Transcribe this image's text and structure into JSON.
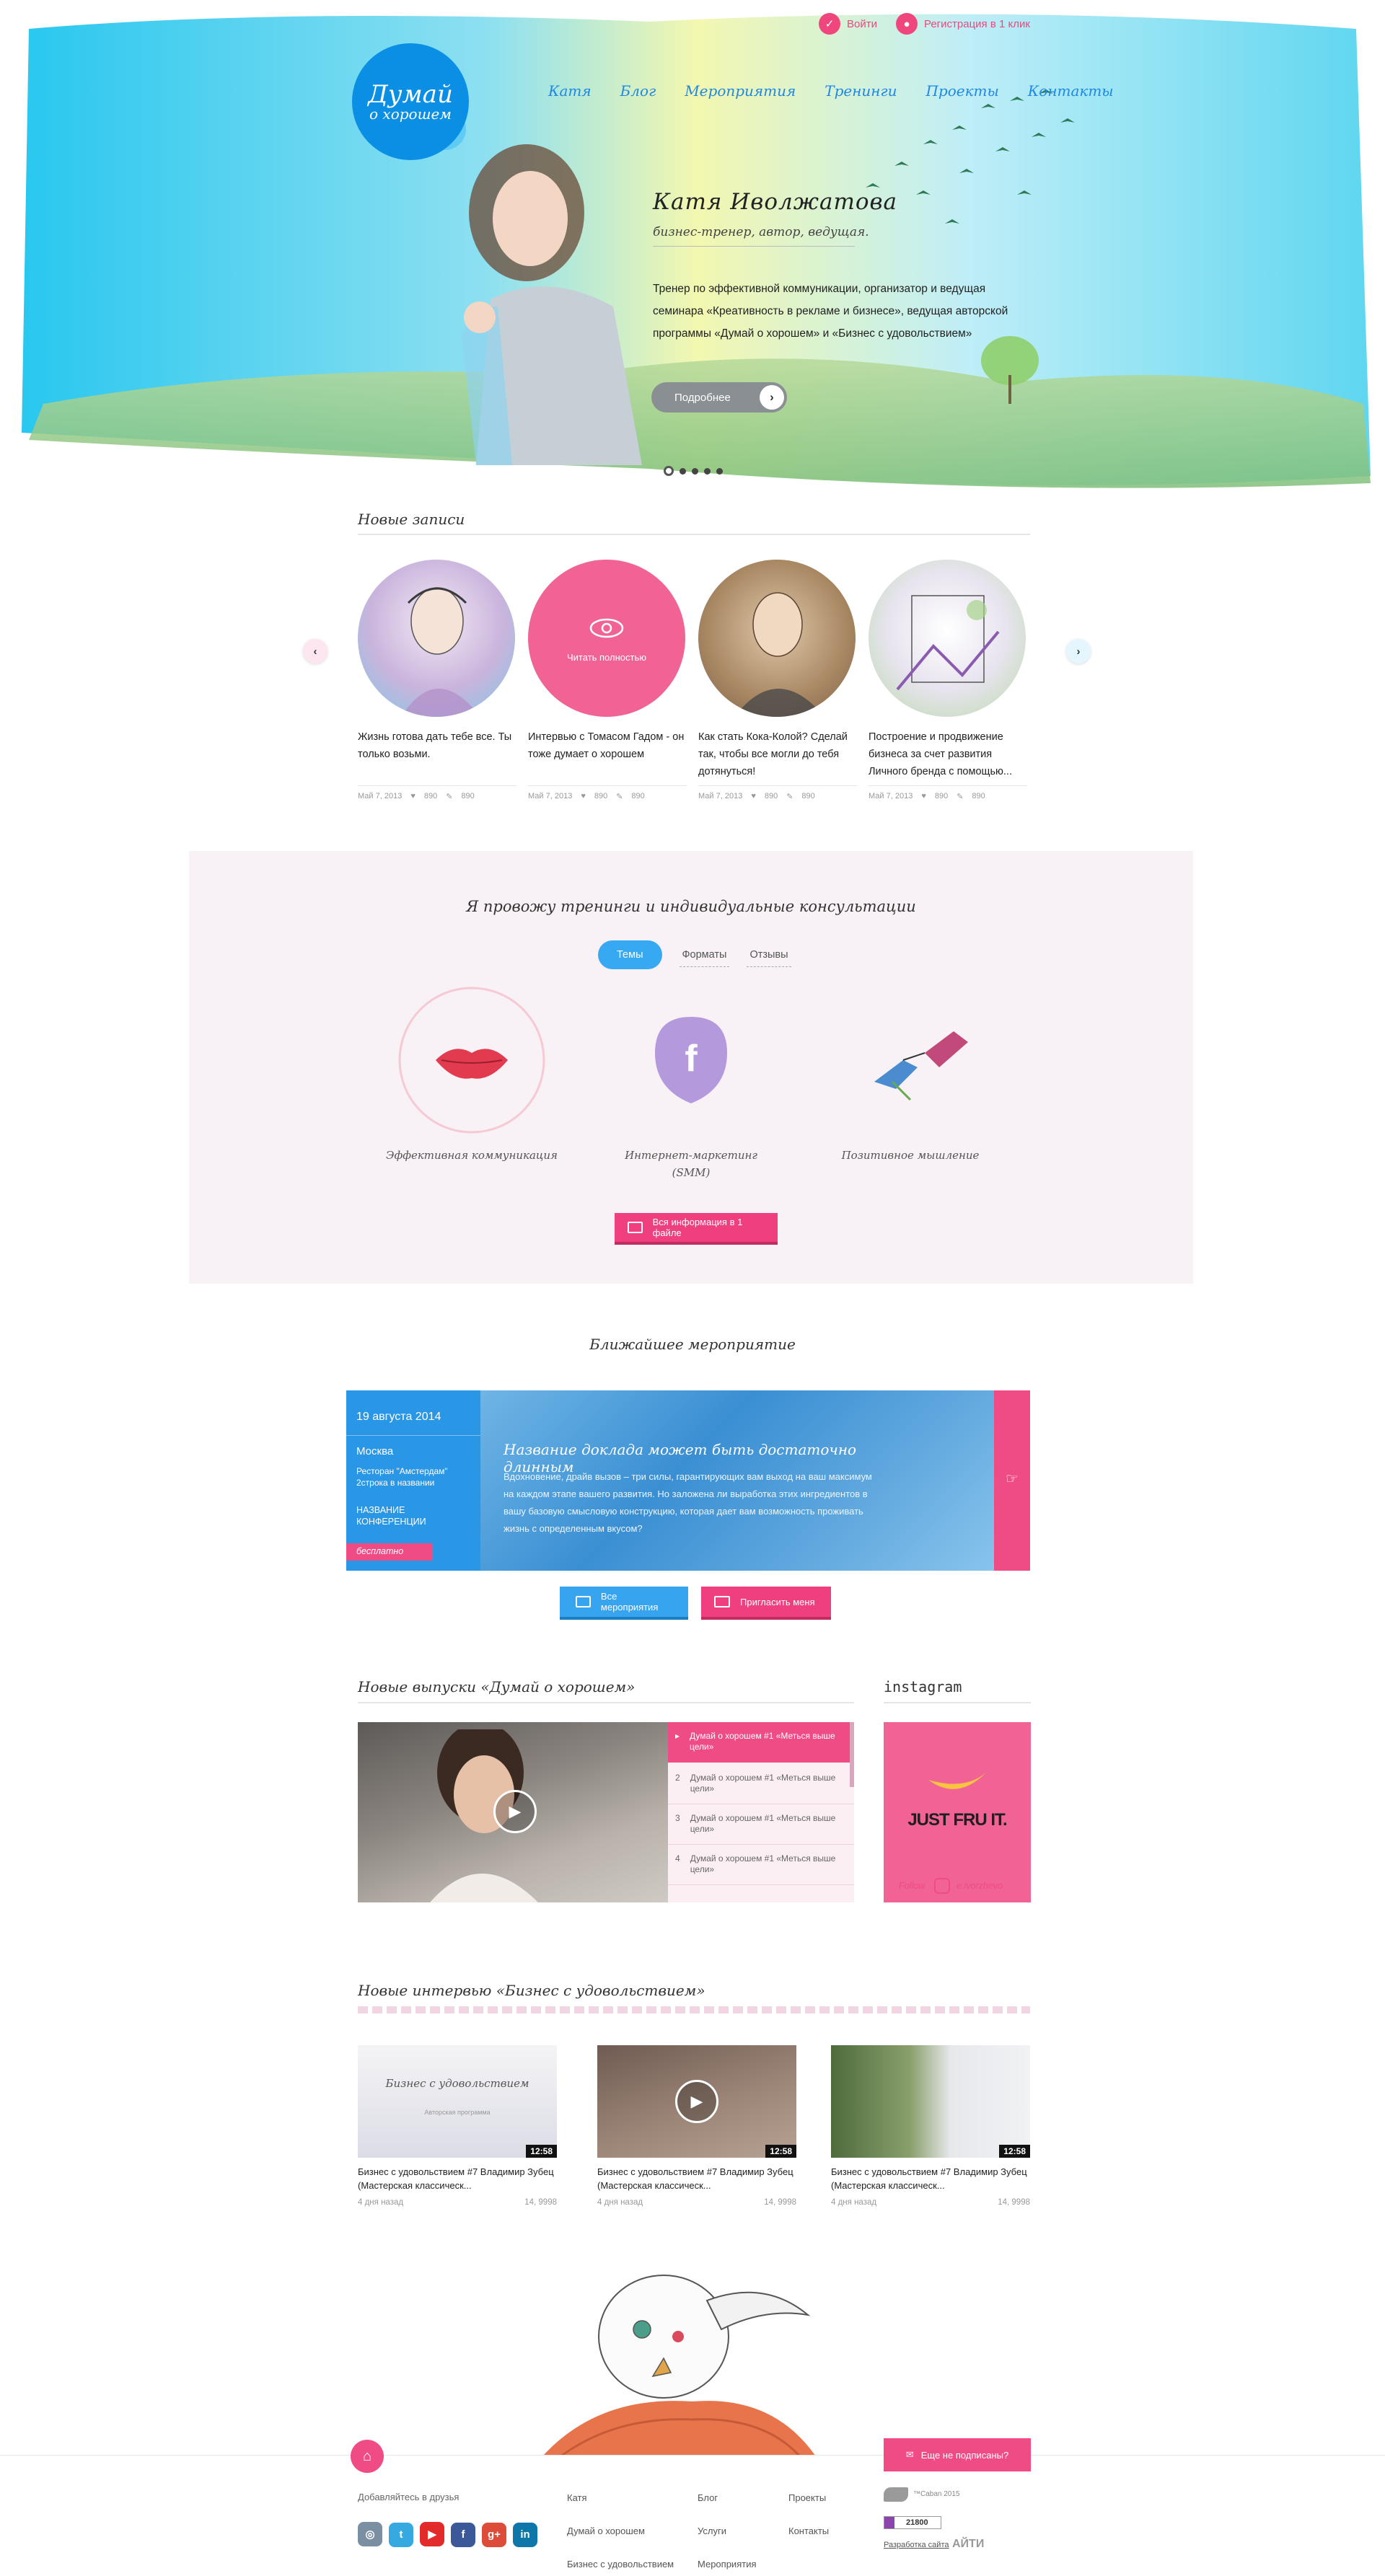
{
  "topbar": {
    "login": "Войти",
    "register": "Регистрация в 1 клик"
  },
  "logo": {
    "line1": "Думай",
    "line2": "о хорошем"
  },
  "nav": [
    "Катя",
    "Блог",
    "Мероприятия",
    "Тренинги",
    "Проекты",
    "Контакты"
  ],
  "hero": {
    "title": "Катя Иволжатова",
    "subtitle": "бизнес-тренер, автор, ведущая.",
    "text": "Тренер по эффективной коммуникации, организатор и ведущая семинара «Креативность в рекламе и бизнесе», ведущая авторской программы «Думай о хорошем» и «Бизнес с удовольствием»",
    "button": "Подробнее"
  },
  "posts_section": {
    "heading": "Новые записи",
    "read_full": "Читать полностью",
    "items": [
      {
        "title": "Жизнь готова дать тебе все. Ты только возьми.",
        "date": "Май 7, 2013",
        "likes": "890",
        "comments": "890"
      },
      {
        "title": "Интервью с Томасом Гадом - он тоже думает о хорошем",
        "date": "Май 7, 2013",
        "likes": "890",
        "comments": "890"
      },
      {
        "title": "Как стать Кока-Колой? Сделай так, чтобы все могли до тебя дотянуться!",
        "date": "Май 7, 2013",
        "likes": "890",
        "comments": "890"
      },
      {
        "title": "Построение и продвижение бизнеса за счет развития Личного бренда с помощью...",
        "date": "Май 7, 2013",
        "likes": "890",
        "comments": "890"
      }
    ]
  },
  "trainings": {
    "heading": "Я провожу тренинги и индивидуальные консультации",
    "tabs": [
      "Темы",
      "Форматы",
      "Отзывы"
    ],
    "topics": [
      "Эффективная коммуникация",
      "Интернет-маркетинг (SMM)",
      "Позитивное мышление"
    ],
    "button": "Вся информация в 1 файле"
  },
  "event": {
    "heading": "Ближайшее мероприятие",
    "date": "19 августа 2014",
    "city": "Москва",
    "place": "Ресторан \"Амстердам\" 2строка в названии",
    "conf": "НАЗВАНИЕ КОНФЕРЕНЦИИ",
    "badge": "бесплатно",
    "title": "Название доклада может быть достаточно длинным",
    "desc": "Вдохновение, драйв вызов – три силы, гарантирующих вам выход на ваш максимум на каждом этапе вашего развития. Но заложена ли выработка этих ингредиентов в вашу базовую смысловую конструкцию, которая дает вам возможность проживать жизнь с определенным вкусом?",
    "btn_all": "Все мероприятия",
    "btn_invite": "Пригласить меня"
  },
  "videos": {
    "heading": "Новые выпуски «Думай о хорошем»",
    "items": [
      {
        "num": "1",
        "title": "Думай о хорошем #1 «Меться выше цели»"
      },
      {
        "num": "2",
        "title": "Думай о хорошем #1 «Меться выше цели»"
      },
      {
        "num": "3",
        "title": "Думай о хорошем #1 «Меться выше цели»"
      },
      {
        "num": "4",
        "title": "Думай о хорошем #1 «Меться выше цели»"
      }
    ]
  },
  "instagram": {
    "heading": "instagram",
    "image_text": "JUST FRU IT.",
    "follow": "Follow",
    "user": "e.ivorzhevo"
  },
  "interviews": {
    "heading": "Новые интервью «Бизнес с удовольствием»",
    "thumb_text": "Бизнес с удовольствием",
    "thumb_sub": "Авторская программа",
    "items": [
      {
        "title": "Бизнес с удовольствием #7 Владимир Зубец (Мастерская классическ...",
        "duration": "12:58",
        "ago": "4 дня назад",
        "views": "14, 9998"
      },
      {
        "title": "Бизнес с удовольствием #7 Владимир Зубец (Мастерская классическ...",
        "duration": "12:58",
        "ago": "4 дня назад",
        "views": "14, 9998"
      },
      {
        "title": "Бизнес с удовольствием #7 Владимир Зубец (Мастерская классическ...",
        "duration": "12:58",
        "ago": "4 дня назад",
        "views": "14, 9998"
      }
    ]
  },
  "subscribe": "Еще не подписаны?",
  "footer": {
    "friends": "Добавляйтесь в друзья",
    "col1": [
      "Катя",
      "Думай о хорошем",
      "Бизнес с удовольствием"
    ],
    "col2": [
      "Блог",
      "Услуги",
      "Мероприятия"
    ],
    "col3": [
      "Проекты",
      "Контакты"
    ],
    "copyright": "™Caban 2015",
    "counter": "21800",
    "dev": "Разработка сайта",
    "dev_brand": "АЙТИ"
  },
  "colors": {
    "pink": "#ef4b84",
    "blue": "#36a4ee",
    "logo_blue": "#0a8fe4"
  }
}
